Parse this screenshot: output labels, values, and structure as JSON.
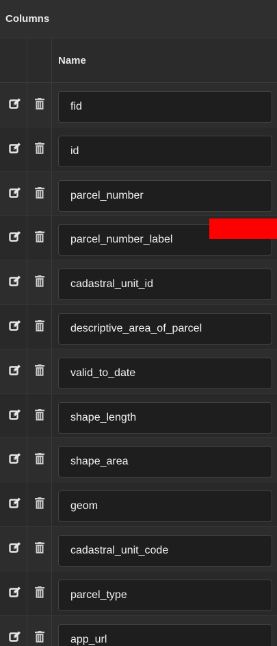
{
  "header": {
    "title": "Columns"
  },
  "table": {
    "name_header": "Name"
  },
  "icons": {
    "edit": "edit-icon",
    "delete": "trash-icon"
  },
  "colors": {
    "background": "#2b2b2b",
    "field": "#1e1e1e",
    "text": "#f2f2f2",
    "redaction": "#ff0000"
  },
  "rows": [
    {
      "name": "fid"
    },
    {
      "name": "id"
    },
    {
      "name": "parcel_number"
    },
    {
      "name": "parcel_number_label"
    },
    {
      "name": "cadastral_unit_id"
    },
    {
      "name": "descriptive_area_of_parcel"
    },
    {
      "name": "valid_to_date"
    },
    {
      "name": "shape_length"
    },
    {
      "name": "shape_area"
    },
    {
      "name": "geom"
    },
    {
      "name": "cadastral_unit_code"
    },
    {
      "name": "parcel_type"
    },
    {
      "name": "app_url"
    }
  ]
}
